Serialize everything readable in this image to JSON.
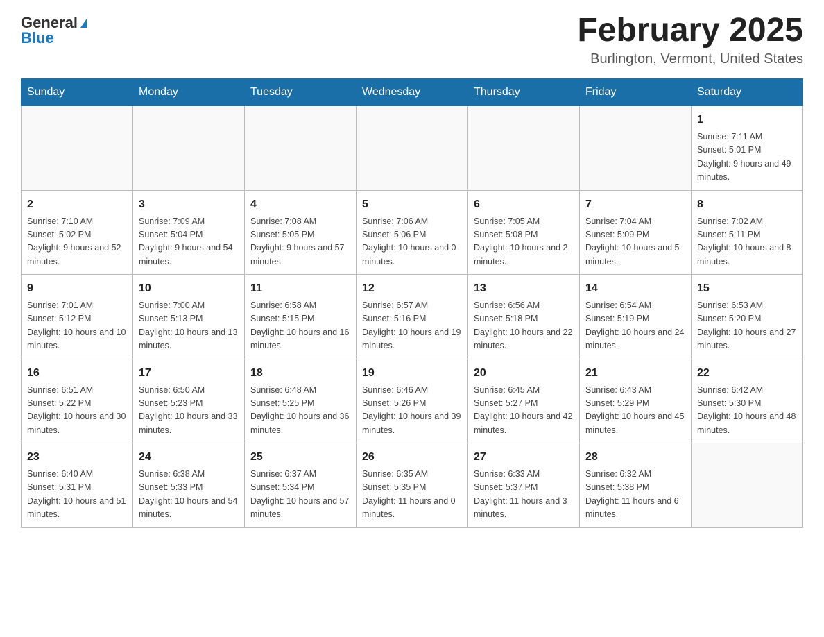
{
  "header": {
    "logo": {
      "general": "General",
      "blue": "Blue"
    },
    "title": "February 2025",
    "location": "Burlington, Vermont, United States"
  },
  "days_of_week": [
    "Sunday",
    "Monday",
    "Tuesday",
    "Wednesday",
    "Thursday",
    "Friday",
    "Saturday"
  ],
  "weeks": [
    [
      {
        "day": "",
        "info": ""
      },
      {
        "day": "",
        "info": ""
      },
      {
        "day": "",
        "info": ""
      },
      {
        "day": "",
        "info": ""
      },
      {
        "day": "",
        "info": ""
      },
      {
        "day": "",
        "info": ""
      },
      {
        "day": "1",
        "info": "Sunrise: 7:11 AM\nSunset: 5:01 PM\nDaylight: 9 hours and 49 minutes."
      }
    ],
    [
      {
        "day": "2",
        "info": "Sunrise: 7:10 AM\nSunset: 5:02 PM\nDaylight: 9 hours and 52 minutes."
      },
      {
        "day": "3",
        "info": "Sunrise: 7:09 AM\nSunset: 5:04 PM\nDaylight: 9 hours and 54 minutes."
      },
      {
        "day": "4",
        "info": "Sunrise: 7:08 AM\nSunset: 5:05 PM\nDaylight: 9 hours and 57 minutes."
      },
      {
        "day": "5",
        "info": "Sunrise: 7:06 AM\nSunset: 5:06 PM\nDaylight: 10 hours and 0 minutes."
      },
      {
        "day": "6",
        "info": "Sunrise: 7:05 AM\nSunset: 5:08 PM\nDaylight: 10 hours and 2 minutes."
      },
      {
        "day": "7",
        "info": "Sunrise: 7:04 AM\nSunset: 5:09 PM\nDaylight: 10 hours and 5 minutes."
      },
      {
        "day": "8",
        "info": "Sunrise: 7:02 AM\nSunset: 5:11 PM\nDaylight: 10 hours and 8 minutes."
      }
    ],
    [
      {
        "day": "9",
        "info": "Sunrise: 7:01 AM\nSunset: 5:12 PM\nDaylight: 10 hours and 10 minutes."
      },
      {
        "day": "10",
        "info": "Sunrise: 7:00 AM\nSunset: 5:13 PM\nDaylight: 10 hours and 13 minutes."
      },
      {
        "day": "11",
        "info": "Sunrise: 6:58 AM\nSunset: 5:15 PM\nDaylight: 10 hours and 16 minutes."
      },
      {
        "day": "12",
        "info": "Sunrise: 6:57 AM\nSunset: 5:16 PM\nDaylight: 10 hours and 19 minutes."
      },
      {
        "day": "13",
        "info": "Sunrise: 6:56 AM\nSunset: 5:18 PM\nDaylight: 10 hours and 22 minutes."
      },
      {
        "day": "14",
        "info": "Sunrise: 6:54 AM\nSunset: 5:19 PM\nDaylight: 10 hours and 24 minutes."
      },
      {
        "day": "15",
        "info": "Sunrise: 6:53 AM\nSunset: 5:20 PM\nDaylight: 10 hours and 27 minutes."
      }
    ],
    [
      {
        "day": "16",
        "info": "Sunrise: 6:51 AM\nSunset: 5:22 PM\nDaylight: 10 hours and 30 minutes."
      },
      {
        "day": "17",
        "info": "Sunrise: 6:50 AM\nSunset: 5:23 PM\nDaylight: 10 hours and 33 minutes."
      },
      {
        "day": "18",
        "info": "Sunrise: 6:48 AM\nSunset: 5:25 PM\nDaylight: 10 hours and 36 minutes."
      },
      {
        "day": "19",
        "info": "Sunrise: 6:46 AM\nSunset: 5:26 PM\nDaylight: 10 hours and 39 minutes."
      },
      {
        "day": "20",
        "info": "Sunrise: 6:45 AM\nSunset: 5:27 PM\nDaylight: 10 hours and 42 minutes."
      },
      {
        "day": "21",
        "info": "Sunrise: 6:43 AM\nSunset: 5:29 PM\nDaylight: 10 hours and 45 minutes."
      },
      {
        "day": "22",
        "info": "Sunrise: 6:42 AM\nSunset: 5:30 PM\nDaylight: 10 hours and 48 minutes."
      }
    ],
    [
      {
        "day": "23",
        "info": "Sunrise: 6:40 AM\nSunset: 5:31 PM\nDaylight: 10 hours and 51 minutes."
      },
      {
        "day": "24",
        "info": "Sunrise: 6:38 AM\nSunset: 5:33 PM\nDaylight: 10 hours and 54 minutes."
      },
      {
        "day": "25",
        "info": "Sunrise: 6:37 AM\nSunset: 5:34 PM\nDaylight: 10 hours and 57 minutes."
      },
      {
        "day": "26",
        "info": "Sunrise: 6:35 AM\nSunset: 5:35 PM\nDaylight: 11 hours and 0 minutes."
      },
      {
        "day": "27",
        "info": "Sunrise: 6:33 AM\nSunset: 5:37 PM\nDaylight: 11 hours and 3 minutes."
      },
      {
        "day": "28",
        "info": "Sunrise: 6:32 AM\nSunset: 5:38 PM\nDaylight: 11 hours and 6 minutes."
      },
      {
        "day": "",
        "info": ""
      }
    ]
  ]
}
